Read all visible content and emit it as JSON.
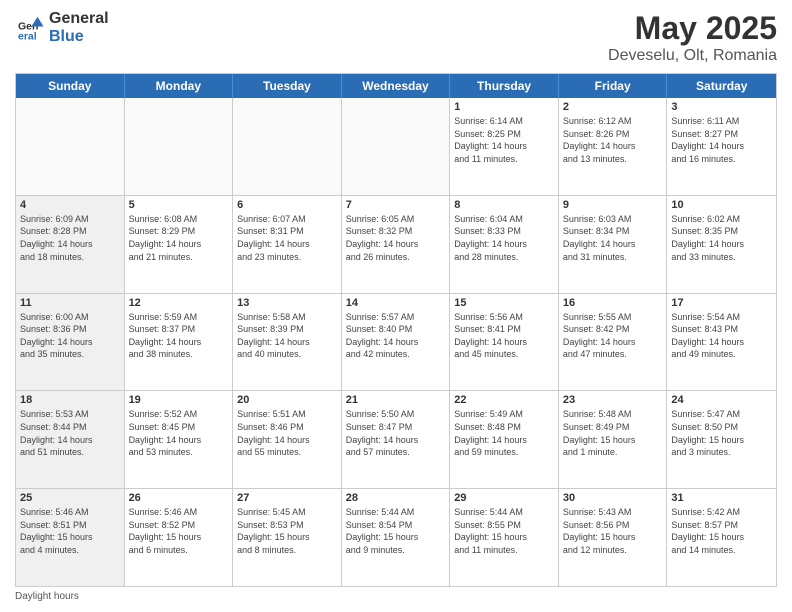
{
  "header": {
    "logo_general": "General",
    "logo_blue": "Blue",
    "title": "May 2025",
    "location": "Deveselu, Olt, Romania"
  },
  "day_headers": [
    "Sunday",
    "Monday",
    "Tuesday",
    "Wednesday",
    "Thursday",
    "Friday",
    "Saturday"
  ],
  "weeks": [
    [
      {
        "date": "",
        "info": "",
        "shaded": true
      },
      {
        "date": "",
        "info": "",
        "shaded": true
      },
      {
        "date": "",
        "info": "",
        "shaded": true
      },
      {
        "date": "",
        "info": "",
        "shaded": true
      },
      {
        "date": "1",
        "info": "Sunrise: 6:14 AM\nSunset: 8:25 PM\nDaylight: 14 hours\nand 11 minutes.",
        "shaded": false
      },
      {
        "date": "2",
        "info": "Sunrise: 6:12 AM\nSunset: 8:26 PM\nDaylight: 14 hours\nand 13 minutes.",
        "shaded": false
      },
      {
        "date": "3",
        "info": "Sunrise: 6:11 AM\nSunset: 8:27 PM\nDaylight: 14 hours\nand 16 minutes.",
        "shaded": false
      }
    ],
    [
      {
        "date": "4",
        "info": "Sunrise: 6:09 AM\nSunset: 8:28 PM\nDaylight: 14 hours\nand 18 minutes.",
        "shaded": true
      },
      {
        "date": "5",
        "info": "Sunrise: 6:08 AM\nSunset: 8:29 PM\nDaylight: 14 hours\nand 21 minutes.",
        "shaded": false
      },
      {
        "date": "6",
        "info": "Sunrise: 6:07 AM\nSunset: 8:31 PM\nDaylight: 14 hours\nand 23 minutes.",
        "shaded": false
      },
      {
        "date": "7",
        "info": "Sunrise: 6:05 AM\nSunset: 8:32 PM\nDaylight: 14 hours\nand 26 minutes.",
        "shaded": false
      },
      {
        "date": "8",
        "info": "Sunrise: 6:04 AM\nSunset: 8:33 PM\nDaylight: 14 hours\nand 28 minutes.",
        "shaded": false
      },
      {
        "date": "9",
        "info": "Sunrise: 6:03 AM\nSunset: 8:34 PM\nDaylight: 14 hours\nand 31 minutes.",
        "shaded": false
      },
      {
        "date": "10",
        "info": "Sunrise: 6:02 AM\nSunset: 8:35 PM\nDaylight: 14 hours\nand 33 minutes.",
        "shaded": false
      }
    ],
    [
      {
        "date": "11",
        "info": "Sunrise: 6:00 AM\nSunset: 8:36 PM\nDaylight: 14 hours\nand 35 minutes.",
        "shaded": true
      },
      {
        "date": "12",
        "info": "Sunrise: 5:59 AM\nSunset: 8:37 PM\nDaylight: 14 hours\nand 38 minutes.",
        "shaded": false
      },
      {
        "date": "13",
        "info": "Sunrise: 5:58 AM\nSunset: 8:39 PM\nDaylight: 14 hours\nand 40 minutes.",
        "shaded": false
      },
      {
        "date": "14",
        "info": "Sunrise: 5:57 AM\nSunset: 8:40 PM\nDaylight: 14 hours\nand 42 minutes.",
        "shaded": false
      },
      {
        "date": "15",
        "info": "Sunrise: 5:56 AM\nSunset: 8:41 PM\nDaylight: 14 hours\nand 45 minutes.",
        "shaded": false
      },
      {
        "date": "16",
        "info": "Sunrise: 5:55 AM\nSunset: 8:42 PM\nDaylight: 14 hours\nand 47 minutes.",
        "shaded": false
      },
      {
        "date": "17",
        "info": "Sunrise: 5:54 AM\nSunset: 8:43 PM\nDaylight: 14 hours\nand 49 minutes.",
        "shaded": false
      }
    ],
    [
      {
        "date": "18",
        "info": "Sunrise: 5:53 AM\nSunset: 8:44 PM\nDaylight: 14 hours\nand 51 minutes.",
        "shaded": true
      },
      {
        "date": "19",
        "info": "Sunrise: 5:52 AM\nSunset: 8:45 PM\nDaylight: 14 hours\nand 53 minutes.",
        "shaded": false
      },
      {
        "date": "20",
        "info": "Sunrise: 5:51 AM\nSunset: 8:46 PM\nDaylight: 14 hours\nand 55 minutes.",
        "shaded": false
      },
      {
        "date": "21",
        "info": "Sunrise: 5:50 AM\nSunset: 8:47 PM\nDaylight: 14 hours\nand 57 minutes.",
        "shaded": false
      },
      {
        "date": "22",
        "info": "Sunrise: 5:49 AM\nSunset: 8:48 PM\nDaylight: 14 hours\nand 59 minutes.",
        "shaded": false
      },
      {
        "date": "23",
        "info": "Sunrise: 5:48 AM\nSunset: 8:49 PM\nDaylight: 15 hours\nand 1 minute.",
        "shaded": false
      },
      {
        "date": "24",
        "info": "Sunrise: 5:47 AM\nSunset: 8:50 PM\nDaylight: 15 hours\nand 3 minutes.",
        "shaded": false
      }
    ],
    [
      {
        "date": "25",
        "info": "Sunrise: 5:46 AM\nSunset: 8:51 PM\nDaylight: 15 hours\nand 4 minutes.",
        "shaded": true
      },
      {
        "date": "26",
        "info": "Sunrise: 5:46 AM\nSunset: 8:52 PM\nDaylight: 15 hours\nand 6 minutes.",
        "shaded": false
      },
      {
        "date": "27",
        "info": "Sunrise: 5:45 AM\nSunset: 8:53 PM\nDaylight: 15 hours\nand 8 minutes.",
        "shaded": false
      },
      {
        "date": "28",
        "info": "Sunrise: 5:44 AM\nSunset: 8:54 PM\nDaylight: 15 hours\nand 9 minutes.",
        "shaded": false
      },
      {
        "date": "29",
        "info": "Sunrise: 5:44 AM\nSunset: 8:55 PM\nDaylight: 15 hours\nand 11 minutes.",
        "shaded": false
      },
      {
        "date": "30",
        "info": "Sunrise: 5:43 AM\nSunset: 8:56 PM\nDaylight: 15 hours\nand 12 minutes.",
        "shaded": false
      },
      {
        "date": "31",
        "info": "Sunrise: 5:42 AM\nSunset: 8:57 PM\nDaylight: 15 hours\nand 14 minutes.",
        "shaded": false
      }
    ]
  ],
  "footer": "Daylight hours"
}
